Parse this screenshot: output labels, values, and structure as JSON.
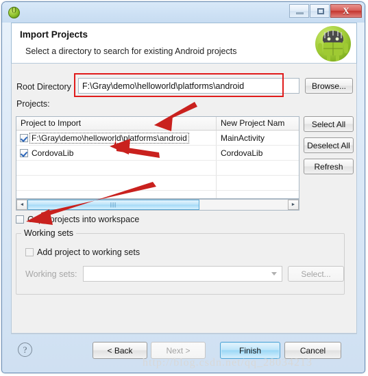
{
  "window": {
    "icon": "eclipse-icon",
    "buttons": {
      "minimize": "minimize-icon",
      "maximize": "maximize-icon",
      "close": "X"
    }
  },
  "header": {
    "title": "Import Projects",
    "subtitle": "Select a directory to search for existing Android projects",
    "logo": "android-logo"
  },
  "form": {
    "root_directory_label": "Root Directory",
    "root_directory_value": "F:\\Gray\\demo\\helloworld\\platforms\\android",
    "browse_label": "Browse...",
    "projects_label": "Projects:"
  },
  "table": {
    "columns": [
      "Project to Import",
      "New Project Nam"
    ],
    "rows": [
      {
        "checked": true,
        "project": "F:\\Gray\\demo\\helloworld\\platforms\\android",
        "new_name": "MainActivity",
        "focused": true
      },
      {
        "checked": true,
        "project": "CordovaLib",
        "new_name": "CordovaLib",
        "focused": false
      }
    ],
    "side_buttons": [
      "Select All",
      "Deselect All",
      "Refresh"
    ],
    "scrollbar": {
      "left_arrow": "◄",
      "right_arrow": "►",
      "thumb_grip": "|||"
    }
  },
  "options": {
    "copy_projects_label": "Copy projects into workspace",
    "copy_projects_checked": false,
    "working_sets_group": "Working sets",
    "add_to_working_sets_label": "Add project to working sets",
    "add_to_working_sets_checked": false,
    "working_sets_field_label": "Working sets:",
    "working_sets_value": "",
    "select_label": "Select..."
  },
  "footer": {
    "help": "?",
    "back_label": "< Back",
    "next_label": "Next >",
    "finish_label": "Finish",
    "cancel_label": "Cancel"
  },
  "watermark": "http://blog.csdn.net/qq_28034213",
  "colors": {
    "annotation": "#e01b1b",
    "default_button": "#4aa3d6",
    "title_bar": "#cfe2f5"
  }
}
